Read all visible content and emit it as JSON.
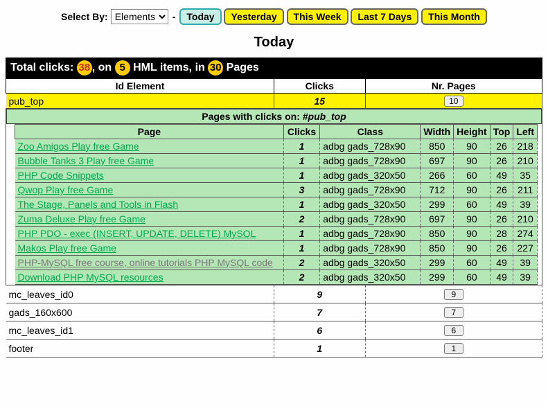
{
  "topbar": {
    "select_label": "Select By:",
    "select_value": "Elements",
    "tabs": [
      "Today",
      "Yesterday",
      "This Week",
      "Last 7 Days",
      "This Month"
    ],
    "active_tab": 0
  },
  "heading": "Today",
  "stats": {
    "prefix": "Total clicks: ",
    "clicks": "38",
    "mid1": ", on ",
    "items": "5",
    "mid2": " HML items, in ",
    "pages": "30",
    "suffix": " Pages"
  },
  "outer_headers": [
    "Id Element",
    "Clicks",
    "Nr. Pages"
  ],
  "selected_row": {
    "id": "pub_top",
    "clicks": "15",
    "nrpages": "10"
  },
  "sub_header_prefix": "Pages with clicks on: ",
  "sub_header_id": "#pub_top",
  "inner_headers": [
    "Page",
    "Clicks",
    "Class",
    "Width",
    "Height",
    "Top",
    "Left"
  ],
  "inner_rows": [
    {
      "page": "Zoo Amigos Play free Game",
      "clicks": "1",
      "class": "adbg gads_728x90",
      "w": "850",
      "h": "90",
      "t": "26",
      "l": "218"
    },
    {
      "page": "Bubble Tanks 3 Play free Game",
      "clicks": "1",
      "class": "adbg gads_728x90",
      "w": "697",
      "h": "90",
      "t": "26",
      "l": "210"
    },
    {
      "page": "PHP Code Snippets",
      "clicks": "1",
      "class": "adbg gads_320x50",
      "w": "266",
      "h": "60",
      "t": "49",
      "l": "35"
    },
    {
      "page": "Qwop Play free Game",
      "clicks": "3",
      "class": "adbg gads_728x90",
      "w": "712",
      "h": "90",
      "t": "26",
      "l": "211"
    },
    {
      "page": "The Stage, Panels and Tools in Flash",
      "clicks": "1",
      "class": "adbg gads_320x50",
      "w": "299",
      "h": "60",
      "t": "49",
      "l": "39"
    },
    {
      "page": "Zuma Deluxe Play free Game",
      "clicks": "2",
      "class": "adbg gads_728x90",
      "w": "697",
      "h": "90",
      "t": "26",
      "l": "210"
    },
    {
      "page": "PHP PDO - exec (INSERT, UPDATE, DELETE) MySQL",
      "clicks": "1",
      "class": "adbg gads_728x90",
      "w": "850",
      "h": "90",
      "t": "28",
      "l": "274"
    },
    {
      "page": "Makos Play free Game",
      "clicks": "1",
      "class": "adbg gads_728x90",
      "w": "850",
      "h": "90",
      "t": "26",
      "l": "227"
    },
    {
      "page": "PHP-MySQL free course, online tutorials PHP MySQL code",
      "clicks": "2",
      "class": "adbg gads_320x50",
      "w": "299",
      "h": "60",
      "t": "49",
      "l": "39",
      "visited": true
    },
    {
      "page": "Download PHP MySQL resources",
      "clicks": "2",
      "class": "adbg gads_320x50",
      "w": "299",
      "h": "60",
      "t": "49",
      "l": "39"
    }
  ],
  "extra_rows": [
    {
      "id": "mc_leaves_id0",
      "clicks": "9",
      "nrpages": "9"
    },
    {
      "id": "gads_160x600",
      "clicks": "7",
      "nrpages": "7"
    },
    {
      "id": "mc_leaves_id1",
      "clicks": "6",
      "nrpages": "6"
    },
    {
      "id": "footer",
      "clicks": "1",
      "nrpages": "1"
    }
  ]
}
